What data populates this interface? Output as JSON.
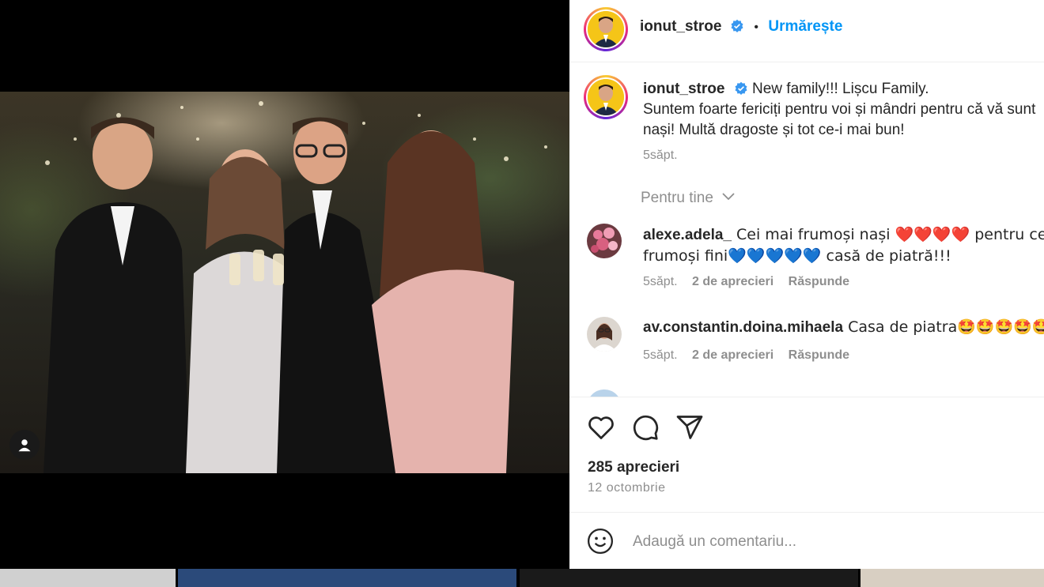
{
  "post": {
    "username": "ionut_stroe",
    "follow_label": "Urmărește",
    "separator": "•",
    "caption_line1": "New family!!! Lișcu Family.",
    "caption_line2": "Suntem foarte fericiți pentru voi și mândri pentru că vă sunt",
    "caption_line3": "nași! Multă dragoste și tot ce-i mai bun!",
    "caption_time": "5săpt.",
    "likes": "285 aprecieri",
    "date": "12 octombrie"
  },
  "comments_header": "Pentru tine",
  "comments": [
    {
      "user": "alexe.adela_",
      "text_line1": " Cei mai frumoși nași ❤️❤️❤️❤️ pentru cei mai",
      "text_line2": "frumoși fini💙💙💙💙💙 casă de piatră!!!",
      "time": "5săpt.",
      "likes": "2 de aprecieri",
      "reply": "Răspunde"
    },
    {
      "user": "av.constantin.doina.mihaela",
      "text_line1": " Casa de piatra🤩🤩🤩🤩🤩",
      "time": "5săpt.",
      "likes": "2 de aprecieri",
      "reply": "Răspunde"
    }
  ],
  "add_comment": {
    "placeholder": "Adaugă un comentariu..."
  },
  "icons": {
    "verified": "verified-badge-icon",
    "chevron": "chevron-down-icon",
    "like": "heart-icon",
    "comment": "comment-bubble-icon",
    "share": "paper-plane-icon",
    "emoji": "emoji-smile-icon",
    "tag": "user-tag-icon"
  },
  "colors": {
    "accent": "#0095f6",
    "text": "#262626",
    "secondary": "#8e8e8e",
    "verified": "#3897f0"
  }
}
